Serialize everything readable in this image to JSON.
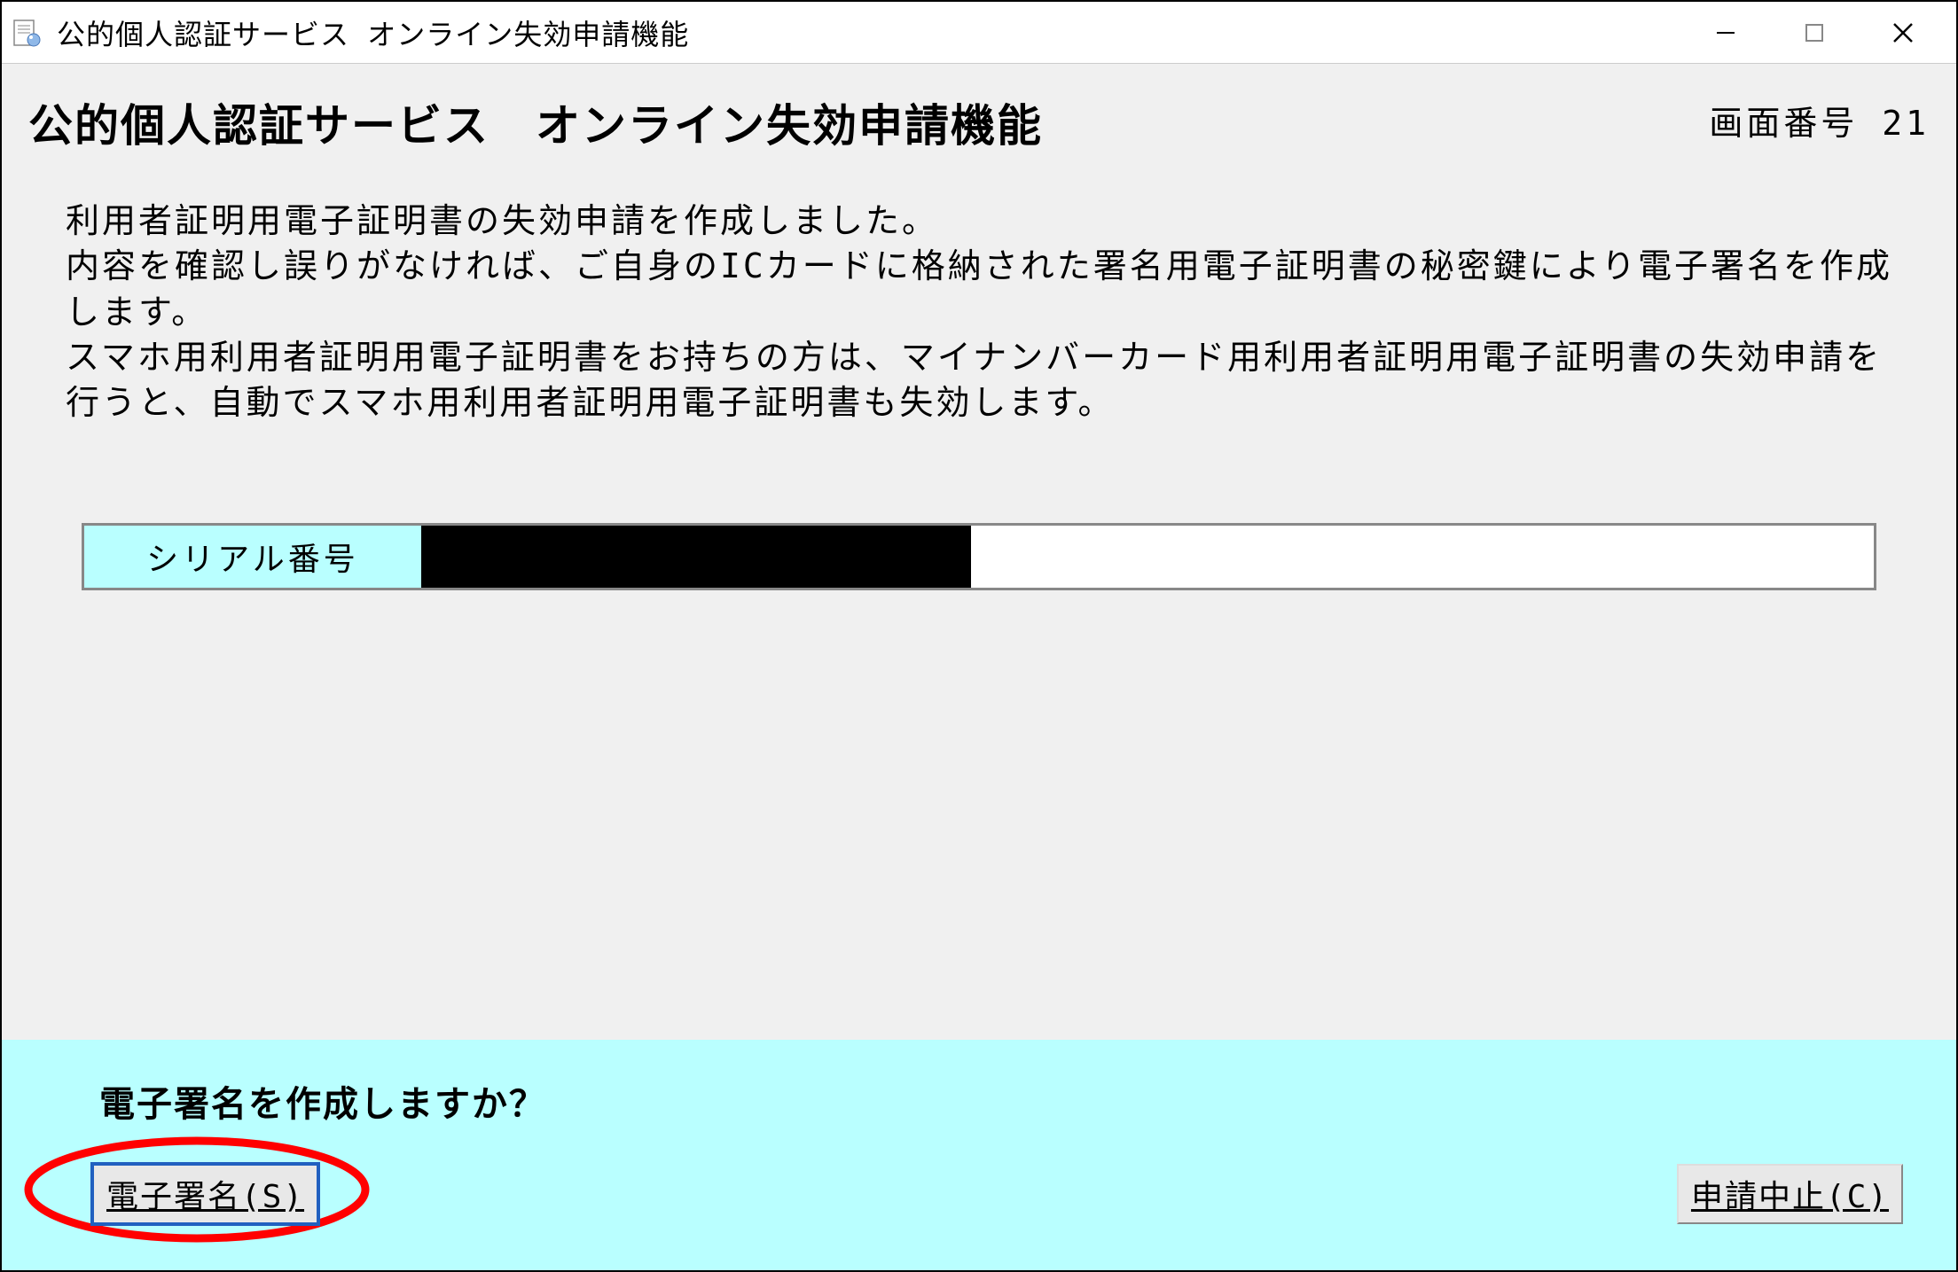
{
  "window": {
    "title": "公的個人認証サービス オンライン失効申請機能"
  },
  "header": {
    "page_title": "公的個人認証サービス　オンライン失効申請機能",
    "screen_number_label": "画面番号  21"
  },
  "instructions": {
    "text": "利用者証明用電子証明書の失効申請を作成しました。\n内容を確認し誤りがなければ、ご自身のICカードに格納された署名用電子証明書の秘密鍵により電子署名を作成します。\nスマホ用利用者証明用電子証明書をお持ちの方は、マイナンバーカード用利用者証明用電子証明書の失効申請を行うと、自動でスマホ用利用者証明用電子証明書も失効します。"
  },
  "serial": {
    "label": "シリアル番号",
    "value_redacted": true
  },
  "footer": {
    "prompt": "電子署名を作成しますか？",
    "sign_button_label": "電子署名(S)",
    "cancel_button_label": "申請中止(C)"
  }
}
